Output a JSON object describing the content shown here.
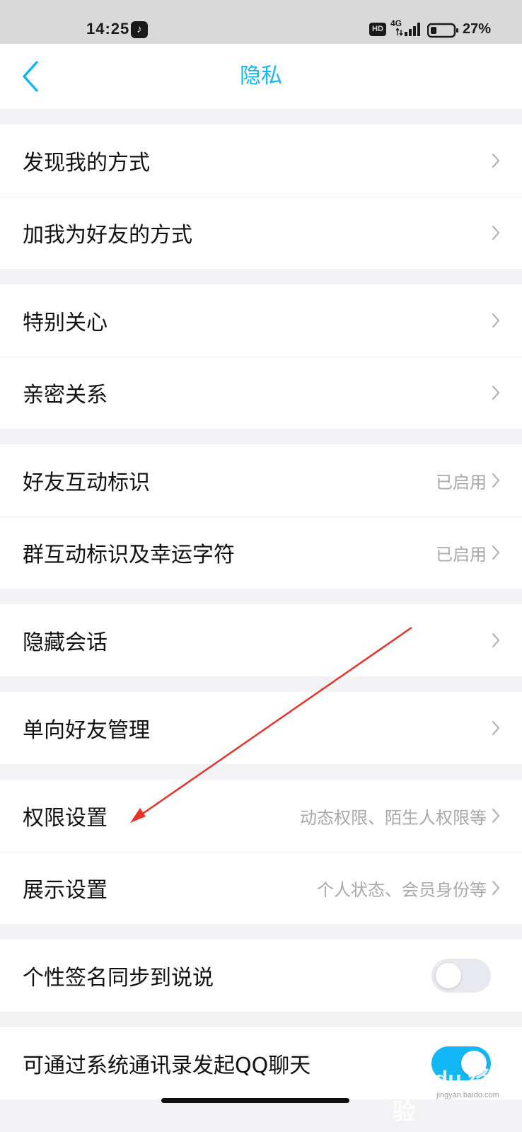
{
  "status_bar": {
    "time": "14:25",
    "network": "4G",
    "hd_label": "HD",
    "battery": "27%",
    "battery_level": 0.27
  },
  "nav": {
    "title": "隐私",
    "back_icon": "chevron-left-icon",
    "accent_color": "#12b7f5"
  },
  "groups": [
    {
      "rows": [
        {
          "label": "发现我的方式",
          "value": ""
        },
        {
          "label": "加我为好友的方式",
          "value": ""
        }
      ]
    },
    {
      "rows": [
        {
          "label": "特别关心",
          "value": ""
        },
        {
          "label": "亲密关系",
          "value": ""
        }
      ]
    },
    {
      "rows": [
        {
          "label": "好友互动标识",
          "value": "已启用"
        },
        {
          "label": "群互动标识及幸运字符",
          "value": "已启用"
        }
      ]
    },
    {
      "rows": [
        {
          "label": "隐藏会话",
          "value": ""
        }
      ]
    },
    {
      "rows": [
        {
          "label": "单向好友管理",
          "value": ""
        }
      ]
    },
    {
      "rows": [
        {
          "label": "权限设置",
          "value": "动态权限、陌生人权限等"
        },
        {
          "label": "展示设置",
          "value": "个人状态、会员身份等"
        }
      ]
    },
    {
      "rows": [
        {
          "label": "个性签名同步到说说",
          "toggle": false
        }
      ]
    },
    {
      "rows": [
        {
          "label": "可通过系统通讯录发起QQ聊天",
          "toggle": true
        }
      ]
    }
  ],
  "annotation": {
    "color": "#e8332a",
    "target": "权限设置"
  },
  "watermark": {
    "logo": "Bai du 经验",
    "sub": "jingyan.baidu.com"
  }
}
